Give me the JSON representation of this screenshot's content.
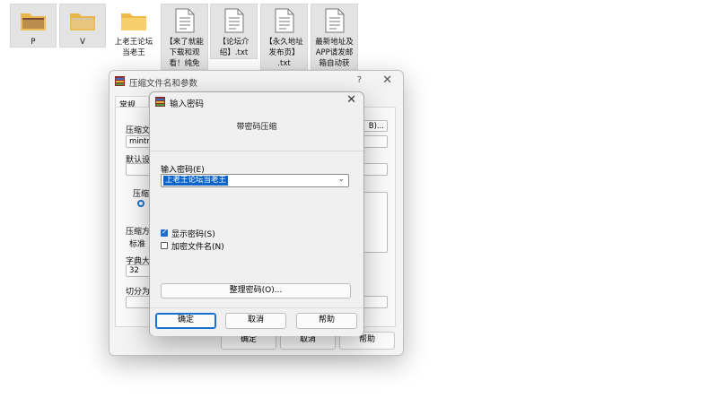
{
  "desktop": {
    "files": [
      {
        "label": "P",
        "type": "folder-thumb"
      },
      {
        "label": "V",
        "type": "folder-thumb"
      },
      {
        "label": "上老王论坛\n当老王",
        "type": "folder"
      },
      {
        "label": "【来了就能\n下载和观\n看！纯免",
        "type": "txt"
      },
      {
        "label": "【论坛介\n绍】.txt",
        "type": "txt"
      },
      {
        "label": "【永久地址\n发布页】\n.txt",
        "type": "txt"
      },
      {
        "label": "最新地址及\nAPP请发邮\n箱自动获",
        "type": "txt"
      }
    ]
  },
  "back_window": {
    "title": "压缩文件名和参数",
    "help": "?",
    "close": "✕",
    "tab": "常规",
    "labels": {
      "archive_name": "压缩文",
      "archive_value": "mintmo",
      "browse": "B)...",
      "default_set": "默认设",
      "format": "压缩",
      "method": "压缩方",
      "method_value": "标准",
      "dict": "字典大",
      "dict_value": "32",
      "split": "切分为"
    },
    "buttons": {
      "ok": "确定",
      "cancel": "取消",
      "help": "帮助"
    }
  },
  "dialog": {
    "title": "输入密码",
    "close": "✕",
    "caption": "带密码压缩",
    "password_label": "输入密码(E)",
    "password_value": "上老王论坛当老王",
    "show_password": {
      "label": "显示密码(S)",
      "checked": true
    },
    "encrypt_names": {
      "label": "加密文件名(N)",
      "checked": false
    },
    "organize_button": "整理密码(O)...",
    "buttons": {
      "ok": "确定",
      "cancel": "取消",
      "help": "帮助"
    }
  },
  "colors": {
    "accent": "#1a6fd1",
    "selection": "#0a64c8"
  }
}
